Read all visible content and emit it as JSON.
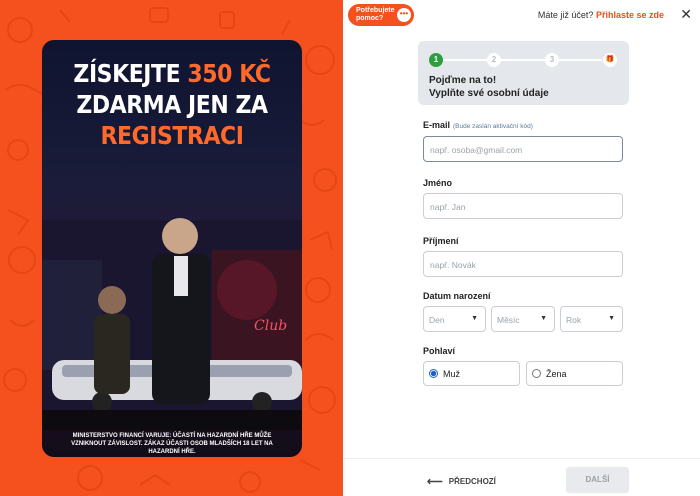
{
  "help": {
    "label": "Potřebujete pomoc?",
    "icon": "chat-bubble-icon"
  },
  "account": {
    "question": "Máte již účet?",
    "login_link": "Přihlaste se zde"
  },
  "close": {
    "icon": "close-icon",
    "glyph": "✕"
  },
  "promo": {
    "line1_white": "ZÍSKEJTE ",
    "line1_orange": "350 KČ",
    "line2": "ZDARMA JEN ZA",
    "line3": "REGISTRACI",
    "disclaimer": "MINISTERSTVO FINANCÍ VARUJE: ÚČASTÍ NA HAZARDNÍ HŘE MŮŽE VZNIKNOUT ZÁVISLOST. ZÁKAZ ÚČASTI OSOB MLADŠÍCH 18 LET NA HAZARDNÍ HŘE."
  },
  "steps": {
    "items": [
      "1",
      "2",
      "3",
      "🎁"
    ],
    "active_index": 0,
    "title_line1": "Pojďme na to!",
    "title_line2": "Vyplňte své osobní údaje"
  },
  "form": {
    "email": {
      "label": "E-mail",
      "hint": "(Bude zaslán aktivační kód)",
      "placeholder": "např. osoba@gmail.com"
    },
    "first_name": {
      "label": "Jméno",
      "placeholder": "např. Jan"
    },
    "last_name": {
      "label": "Příjmení",
      "placeholder": "např. Novák"
    },
    "birth": {
      "label": "Datum narození",
      "day": "Den",
      "month": "Měsíc",
      "year": "Rok"
    },
    "gender": {
      "label": "Pohlaví",
      "options": [
        "Muž",
        "Žena"
      ],
      "selected": "Muž"
    }
  },
  "nav": {
    "prev": "PŘEDCHOZÍ",
    "next": "DALŠÍ"
  },
  "colors": {
    "brand_orange": "#f4511e",
    "step_active": "#2e9e3e",
    "link": "#e8501e"
  }
}
